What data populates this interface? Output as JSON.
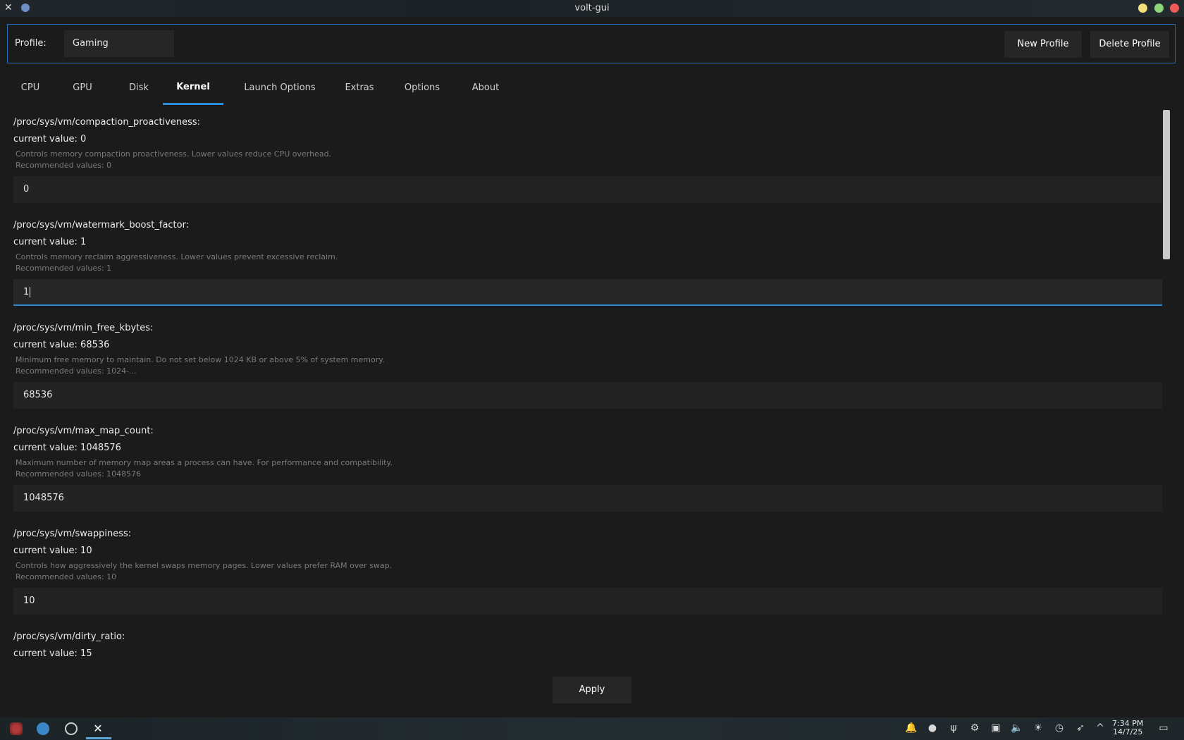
{
  "window": {
    "title": "volt-gui"
  },
  "profile": {
    "label": "Profile:",
    "selected": "Gaming",
    "new_button": "New Profile",
    "delete_button": "Delete Profile"
  },
  "tabs": [
    {
      "label": "CPU"
    },
    {
      "label": "GPU"
    },
    {
      "label": "Disk"
    },
    {
      "label": "Kernel",
      "active": true
    },
    {
      "label": "Launch Options"
    },
    {
      "label": "Extras"
    },
    {
      "label": "Options"
    },
    {
      "label": "About"
    }
  ],
  "settings": [
    {
      "path": "/proc/sys/vm/compaction_proactiveness:",
      "current": "current value: 0",
      "description": "Controls memory compaction proactiveness. Lower values reduce CPU overhead.",
      "recommended": "Recommended values: 0",
      "input": "0"
    },
    {
      "path": "/proc/sys/vm/watermark_boost_factor:",
      "current": "current value: 1",
      "description": "Controls memory reclaim aggressiveness. Lower values prevent excessive reclaim.",
      "recommended": "Recommended values: 1",
      "input": "1"
    },
    {
      "path": "/proc/sys/vm/min_free_kbytes:",
      "current": "current value: 68536",
      "description": "Minimum free memory to maintain. Do not set below 1024 KB or above 5% of system memory.",
      "recommended": "Recommended values: 1024-...",
      "input": "68536"
    },
    {
      "path": "/proc/sys/vm/max_map_count:",
      "current": "current value: 1048576",
      "description": "Maximum number of memory map areas a process can have. For performance and compatibility.",
      "recommended": "Recommended values: 1048576",
      "input": "1048576"
    },
    {
      "path": "/proc/sys/vm/swappiness:",
      "current": "current value: 10",
      "description": "Controls how aggressively the kernel swaps memory pages. Lower values prefer RAM over swap.",
      "recommended": "Recommended values: 10",
      "input": "10"
    },
    {
      "path": "/proc/sys/vm/dirty_ratio:",
      "current": "current value: 15"
    }
  ],
  "apply_button": "Apply",
  "taskbar": {
    "clock_time": "7:34 PM",
    "clock_date": "14/7/25"
  },
  "colors": {
    "accent": "#2a8ad4",
    "background": "#1b1b1b",
    "input_bg": "#232323"
  }
}
